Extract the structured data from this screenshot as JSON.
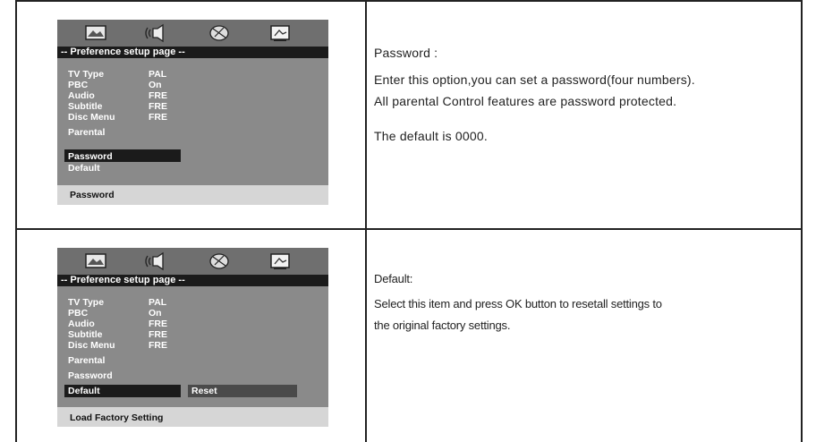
{
  "panel1": {
    "icons": [
      "general-setup-icon",
      "audio-setup-icon",
      "video-setup-icon",
      "preference-setup-icon"
    ],
    "title": "-- Preference setup page --",
    "items": [
      {
        "label": "TV Type",
        "value": "PAL"
      },
      {
        "label": "PBC",
        "value": "On"
      },
      {
        "label": "Audio",
        "value": "FRE"
      },
      {
        "label": "Subtitle",
        "value": "FRE"
      },
      {
        "label": "Disc Menu",
        "value": "FRE"
      },
      {
        "label": "Parental",
        "value": ""
      },
      {
        "label": "Password",
        "value": ""
      },
      {
        "label": "Default",
        "value": ""
      }
    ],
    "status": "Password"
  },
  "panel2": {
    "icons": [
      "general-setup-icon",
      "audio-setup-icon",
      "video-setup-icon",
      "preference-setup-icon"
    ],
    "title": "-- Preference setup page --",
    "items": [
      {
        "label": "TV Type",
        "value": "PAL"
      },
      {
        "label": "PBC",
        "value": "On"
      },
      {
        "label": "Audio",
        "value": "FRE"
      },
      {
        "label": "Subtitle",
        "value": "FRE"
      },
      {
        "label": "Disc Menu",
        "value": "FRE"
      },
      {
        "label": "Parental",
        "value": ""
      },
      {
        "label": "Password",
        "value": ""
      },
      {
        "label": "Default",
        "value": ""
      }
    ],
    "submenu": "Reset",
    "status": "Load Factory Setting"
  },
  "desc1": {
    "heading": "Password  :",
    "line1": "Enter this option,you can set a password(four numbers).",
    "line2": "All parental Control features are password protected.",
    "line3": "The default is 0000."
  },
  "desc2": {
    "heading": "Default:",
    "line1": "Select this item and press OK button to resetall settings to",
    "line2": "the original factory settings."
  }
}
